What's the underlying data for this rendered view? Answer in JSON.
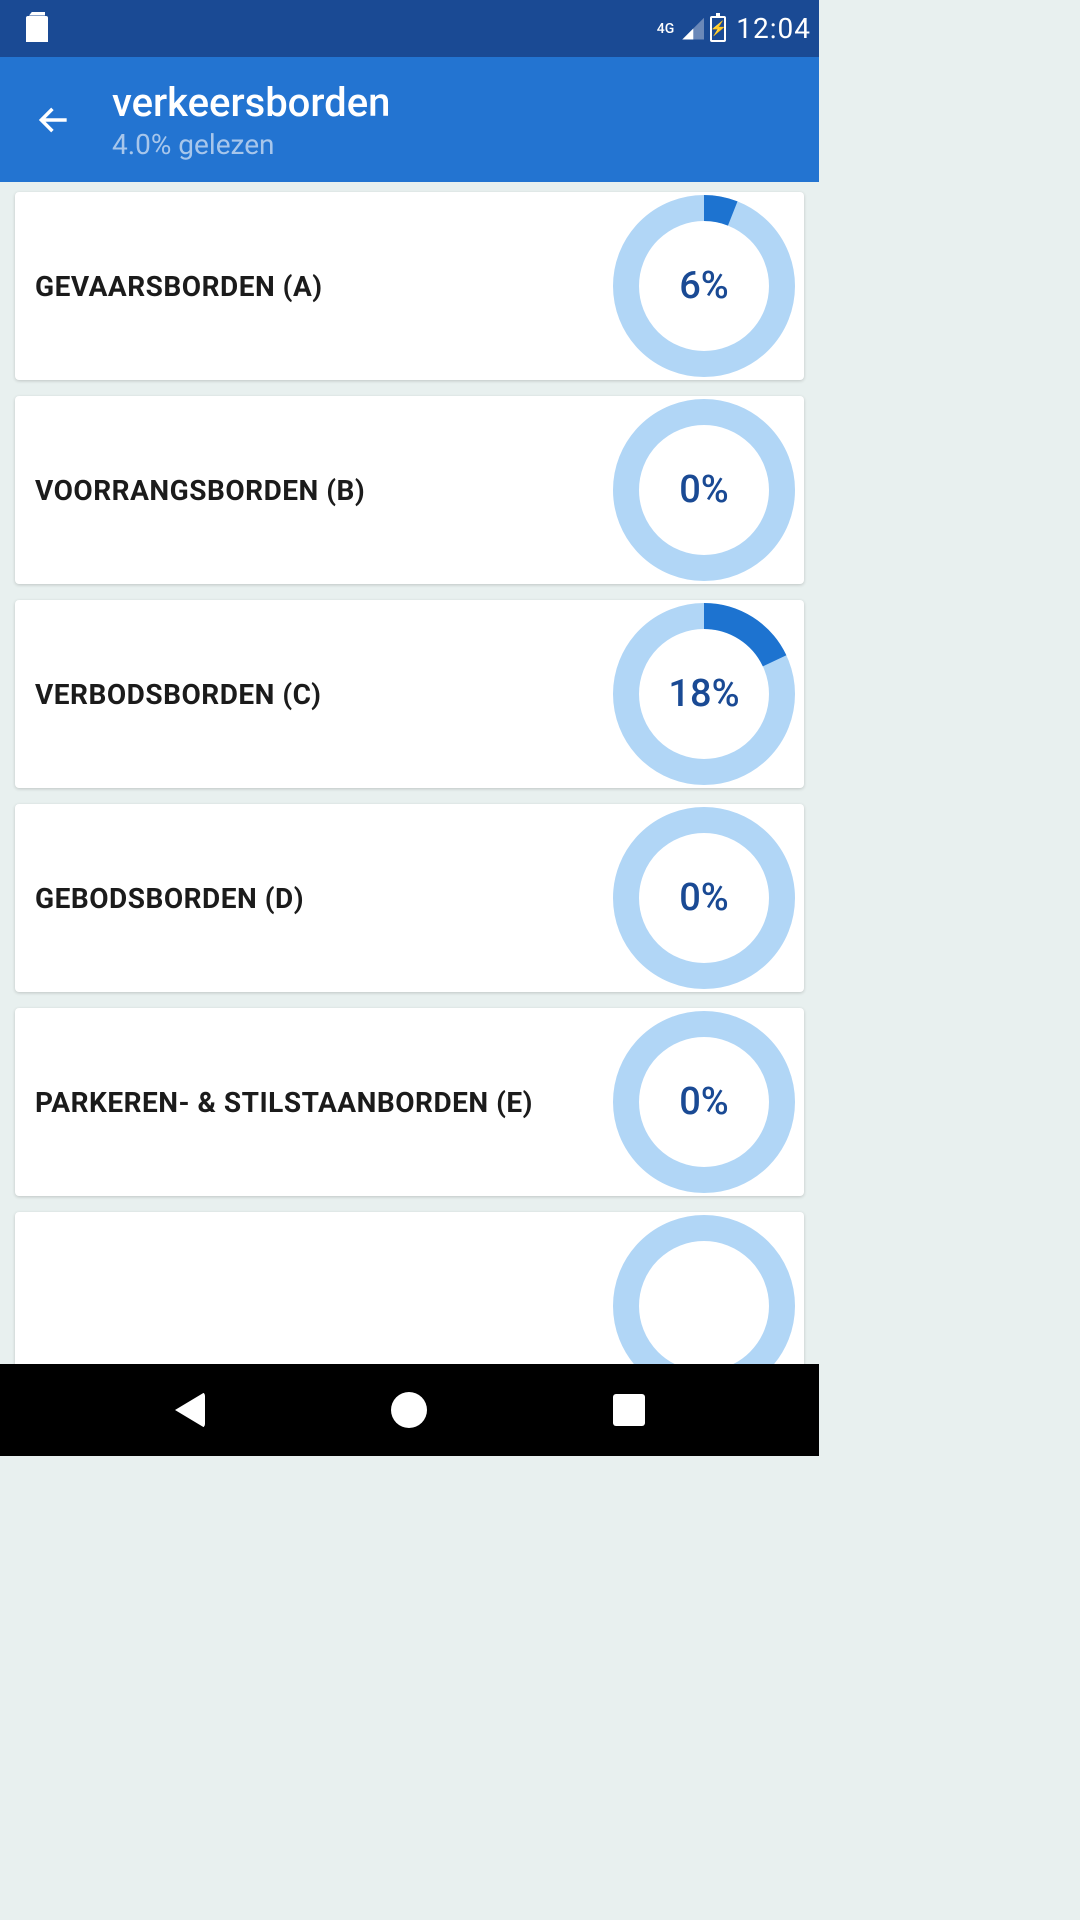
{
  "status": {
    "network_label": "4G",
    "time": "12:04"
  },
  "header": {
    "title": "verkeersborden",
    "subtitle": "4.0% gelezen"
  },
  "categories": [
    {
      "label": "GEVAARSBORDEN (A)",
      "percent": 6,
      "percent_label": "6%"
    },
    {
      "label": "VOORRANGSBORDEN (B)",
      "percent": 0,
      "percent_label": "0%"
    },
    {
      "label": "VERBODSBORDEN (C)",
      "percent": 18,
      "percent_label": "18%"
    },
    {
      "label": "GEBODSBORDEN (D)",
      "percent": 0,
      "percent_label": "0%"
    },
    {
      "label": "PARKEREN- & STILSTAANBORDEN (E)",
      "percent": 0,
      "percent_label": "0%"
    },
    {
      "label": "",
      "percent": 0,
      "percent_label": ""
    }
  ],
  "colors": {
    "status_bar": "#1a4a94",
    "app_bar": "#2374d1",
    "ring_track": "#b1d6f6",
    "ring_progress": "#1d73d0",
    "percent_text": "#1a4a94"
  }
}
